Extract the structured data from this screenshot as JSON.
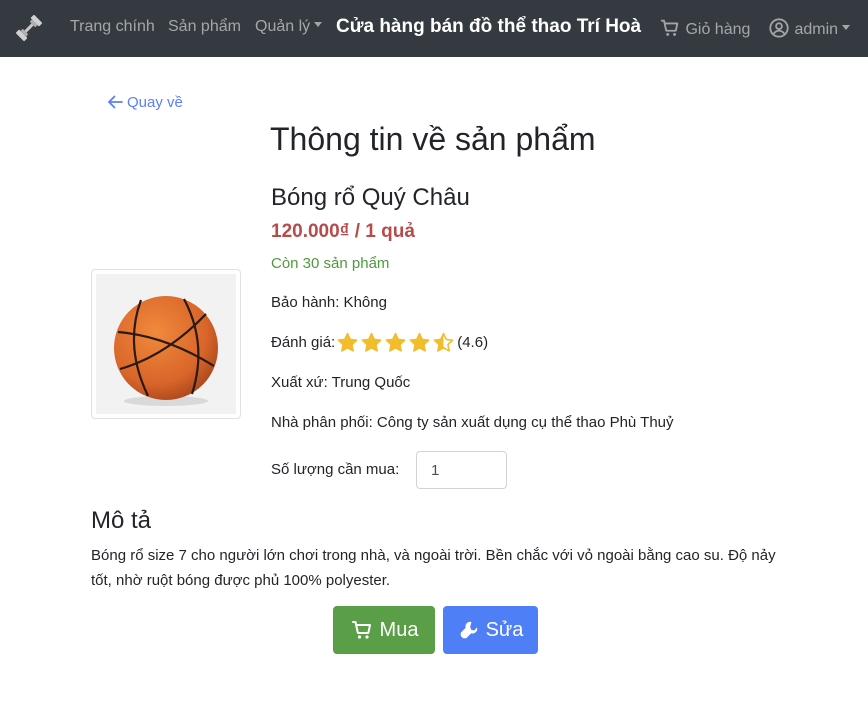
{
  "navbar": {
    "links": [
      {
        "label": "Trang chính"
      },
      {
        "label": "Sản phẩm"
      },
      {
        "label": "Quản lý"
      }
    ],
    "store_title": "Cửa hàng bán đồ thể thao Trí Hoà",
    "cart_label": "Giỏ hàng",
    "user_label": "admin"
  },
  "back_label": "Quay về",
  "page_title": "Thông tin về sản phẩm",
  "product": {
    "name": "Bóng rổ Quý Châu",
    "price": "120.000₫ / 1 quả",
    "stock": "Còn 30 sản phẩm",
    "warranty": "Bảo hành: Không",
    "rating_label": "Đánh giá:",
    "rating_value": 4.6,
    "rating_text": "(4.6)",
    "origin": "Xuất xứ: Trung Quốc",
    "distributor": "Nhà phân phối: Công ty sản xuất dụng cụ thể thao Phù Thuỷ",
    "quantity_label": "Số lượng cần mua:",
    "quantity_value": "1"
  },
  "description": {
    "heading": "Mô tả",
    "text": "Bóng rổ size 7 cho người lớn chơi trong nhà, và ngoài trời. Bền chắc với vỏ ngoài bằng cao su. Độ nảy tốt, nhờ ruột bóng được phủ 100% polyester."
  },
  "buttons": {
    "buy": "Mua",
    "edit": "Sửa"
  },
  "colors": {
    "navbar_bg": "#343a40",
    "price": "#b74b4b",
    "stock": "#4e9a3e",
    "buy_button": "#5b9e48",
    "edit_button": "#4e7ff7",
    "link": "#5b7ff5",
    "star": "#f2bd2c"
  },
  "icons": [
    "dumbbell-icon",
    "cart-icon",
    "user-circle-icon",
    "arrow-left-icon",
    "star-icon",
    "wrench-icon"
  ]
}
